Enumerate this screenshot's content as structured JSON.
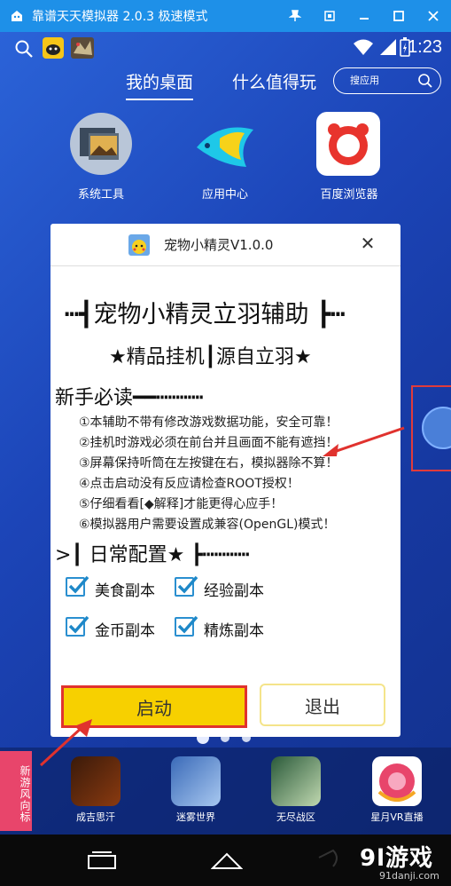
{
  "emulator": {
    "title": "靠谱天天模拟器 2.0.3 极速模式",
    "controls": [
      "pin",
      "restore",
      "minimize",
      "maximize",
      "close"
    ]
  },
  "statusbar": {
    "time": "1:23",
    "icons": [
      "search-icon",
      "app-notification-icon",
      "game-notification-icon",
      "wifi-icon",
      "signal-icon",
      "battery-icon"
    ]
  },
  "tabs": {
    "desktop": "我的桌面",
    "recommend": "什么值得玩",
    "search_placeholder": "搜应用"
  },
  "desktop_icons": [
    {
      "label": "系统工具",
      "icon": "system-tools-icon"
    },
    {
      "label": "应用中心",
      "icon": "app-center-icon"
    },
    {
      "label": "百度浏览器",
      "icon": "baidu-browser-icon"
    }
  ],
  "dialog": {
    "title": "宠物小精灵V1.0.0",
    "heading": "┅┫宠物小精灵立羽辅助 ┣┅",
    "subheading": "★精品挂机┃源自立羽★",
    "section_notice": "新手必读━━┅┅┅┅",
    "notices": [
      "①本辅助不带有修改游戏数据功能，安全可靠！",
      "②挂机时游戏必须在前台并且画面不能有遮挡！",
      "③屏幕保持听筒在左按键在右，模拟器除不算！",
      "④点击启动没有反应请检查ROOT授权！",
      "⑤仔细看看[◆解释]才能更得心应手！",
      "⑥模拟器用户需要设置成兼容(OpenGL)模式！"
    ],
    "section_config": ">┃ 日常配置★ ┣┅┅┅┅",
    "options": [
      {
        "label": "美食副本",
        "checked": true
      },
      {
        "label": "经验副本",
        "checked": true
      },
      {
        "label": "金币副本",
        "checked": true
      },
      {
        "label": "精炼副本",
        "checked": true
      }
    ],
    "start_label": "启动",
    "exit_label": "退出"
  },
  "dock": {
    "tag": "新游风向标",
    "apps": [
      {
        "label": "成吉思汗"
      },
      {
        "label": "迷雾世界"
      },
      {
        "label": "无尽战区"
      },
      {
        "label": "星月VR直播"
      }
    ]
  },
  "watermark": {
    "brand": "9l游戏",
    "url": "91danji.com"
  },
  "colors": {
    "titlebar": "#1e90e8",
    "start_button": "#f7d000",
    "highlight_box": "#e0322e",
    "checkbox": "#2a8fd0"
  }
}
